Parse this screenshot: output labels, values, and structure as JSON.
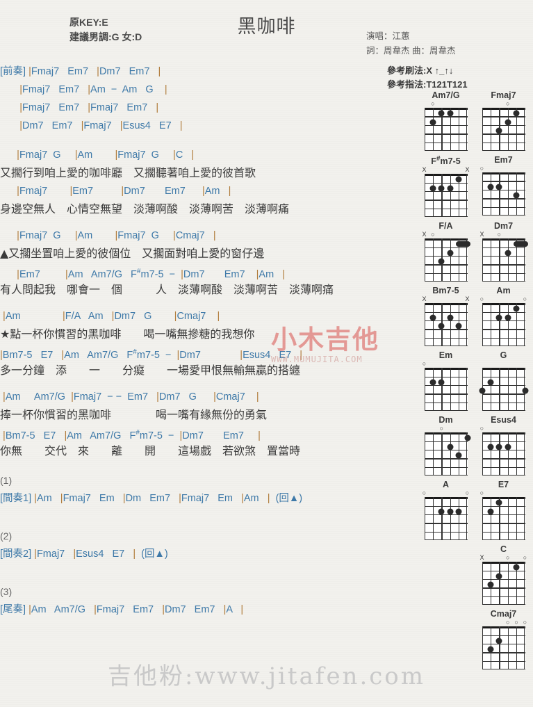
{
  "header": {
    "title": "黑咖啡",
    "orig_key": "原KEY:E",
    "suggest_key": "建議男調:G 女:D",
    "singer": "演唱：江蕙",
    "writer": "詞：周韋杰  曲：周韋杰",
    "strum": "參考刷法:X ↑_↑↓",
    "fingerstyle": "參考指法:T121T121"
  },
  "sections": [
    {
      "name": "intro",
      "label": "[前奏]",
      "lines": [
        {
          "type": "chord",
          "text": "[前奏] |Fmaj7   Em7   |Dm7   Em7   |"
        },
        {
          "type": "chord",
          "text": "       |Fmaj7   Em7   |Am  −  Am   G    |"
        },
        {
          "type": "chord",
          "text": "       |Fmaj7   Em7   |Fmaj7   Em7   |"
        },
        {
          "type": "chord",
          "text": "       |Dm7   Em7   |Fmaj7   |Esus4   E7   |"
        }
      ]
    },
    {
      "name": "verse-1",
      "lines": [
        {
          "type": "chord",
          "text": "      |Fmaj7  G     |Am        |Fmaj7  G     |C   |"
        },
        {
          "type": "lyric",
          "text": "又擱行到咱上愛的咖啡廳　又擱聽著咱上愛的彼首歌"
        },
        {
          "type": "chord",
          "text": "      |Fmaj7        |Em7          |Dm7       Em7      |Am   |"
        },
        {
          "type": "lyric",
          "text": "身邊空無人　心情空無望　淡薄啊酸　淡薄啊苦　淡薄啊痛"
        }
      ]
    },
    {
      "name": "verse-2",
      "lines": [
        {
          "type": "chord",
          "text": "      |Fmaj7  G     |Am        |Fmaj7  G     |Cmaj7   |"
        },
        {
          "type": "lyric",
          "text": "▲又擱坐置咱上愛的彼個位　又擱面對咱上愛的窗仔邊"
        },
        {
          "type": "chord",
          "text": "      |Em7         |Am   Am7/G   F#m7-5  −  |Dm7       Em7    |Am   |"
        },
        {
          "type": "lyric",
          "text": "有人問起我　哪會一　個　　　人　淡薄啊酸　淡薄啊苦　淡薄啊痛"
        }
      ]
    },
    {
      "name": "chorus-1",
      "lines": [
        {
          "type": "chord",
          "text": " |Am               |F/A   Am   |Dm7   G        |Cmaj7    |"
        },
        {
          "type": "lyric",
          "text": "★點一杯你慣習的黑咖啡　　喝一嘴無摻糖的我想你"
        },
        {
          "type": "chord",
          "text": "|Bm7-5   E7   |Am   Am7/G   F#m7-5  −  |Dm7              |Esus4   E7   |"
        },
        {
          "type": "lyric",
          "text": "多一分鐘　添　　一　　分癡　　一場愛甲恨無輸無贏的搭纏"
        }
      ]
    },
    {
      "name": "chorus-2",
      "lines": [
        {
          "type": "chord",
          "text": " |Am     Am7/G  |Fmaj7  − −  Em7   |Dm7   G      |Cmaj7    |"
        },
        {
          "type": "lyric",
          "text": "捧一杯你慣習的黑咖啡　　　　喝一嘴有緣無份的勇氣"
        },
        {
          "type": "chord",
          "text": " |Bm7-5   E7   |Am   Am7/G   F#m7-5  −  |Dm7       Em7     |"
        },
        {
          "type": "lyric",
          "text": "你無　　交代　來　　離　　開　　這場戲　若欲煞　置當時"
        }
      ]
    }
  ],
  "outro_blocks": [
    {
      "num": "(1)",
      "label": "[間奏1]",
      "chords": "|Am   |Fmaj7   Em   |Dm   Em7   |Fmaj7   Em   |Am   |  (回▲)"
    },
    {
      "num": "(2)",
      "label": "[間奏2]",
      "chords": "|Fmaj7   |Esus4   E7   |  (回▲)"
    },
    {
      "num": "(3)",
      "label": "[尾奏]",
      "chords": "|Am   Am7/G   |Fmaj7   Em7   |Dm7   Em7   |A   |"
    }
  ],
  "diagrams": [
    {
      "name": "Am7/G",
      "markers": [
        {
          "sym": "○",
          "string": 5
        }
      ],
      "dots": [
        {
          "s": 5,
          "f": 2
        },
        {
          "s": 4,
          "f": 1
        },
        {
          "s": 3,
          "f": 1
        }
      ],
      "barre": null
    },
    {
      "name": "Fmaj7",
      "markers": [
        {
          "sym": "○",
          "string": 3
        }
      ],
      "dots": [
        {
          "s": 4,
          "f": 3
        },
        {
          "s": 3,
          "f": 2
        },
        {
          "s": 2,
          "f": 1
        }
      ],
      "barre": null
    },
    {
      "name": "F#m7-5",
      "markers": [
        {
          "sym": "X",
          "string": 6
        },
        {
          "sym": "X",
          "string": 1
        }
      ],
      "dots": [
        {
          "s": 5,
          "f": 2
        },
        {
          "s": 4,
          "f": 2
        },
        {
          "s": 3,
          "f": 2
        },
        {
          "s": 2,
          "f": 1
        }
      ],
      "barre": null
    },
    {
      "name": "Em7",
      "markers": [
        {
          "sym": "○",
          "string": 6
        }
      ],
      "dots": [
        {
          "s": 5,
          "f": 2
        },
        {
          "s": 4,
          "f": 2
        },
        {
          "s": 2,
          "f": 3
        }
      ],
      "barre": null
    },
    {
      "name": "F/A",
      "markers": [
        {
          "sym": "X",
          "string": 6
        },
        {
          "sym": "○",
          "string": 5
        }
      ],
      "dots": [
        {
          "s": 4,
          "f": 3
        },
        {
          "s": 3,
          "f": 2
        }
      ],
      "barre": {
        "from": 2,
        "to": 1,
        "f": 1
      }
    },
    {
      "name": "Dm7",
      "markers": [
        {
          "sym": "X",
          "string": 6
        },
        {
          "sym": "○",
          "string": 4
        }
      ],
      "dots": [
        {
          "s": 3,
          "f": 2
        }
      ],
      "barre": {
        "from": 2,
        "to": 1,
        "f": 1
      }
    },
    {
      "name": "Bm7-5",
      "markers": [
        {
          "sym": "X",
          "string": 6
        },
        {
          "sym": "X",
          "string": 1
        }
      ],
      "dots": [
        {
          "s": 5,
          "f": 2
        },
        {
          "s": 3,
          "f": 2
        },
        {
          "s": 4,
          "f": 3
        },
        {
          "s": 2,
          "f": 3
        }
      ],
      "barre": null
    },
    {
      "name": "Am",
      "markers": [
        {
          "sym": "○",
          "string": 6
        },
        {
          "sym": "○",
          "string": 1
        }
      ],
      "dots": [
        {
          "s": 4,
          "f": 2
        },
        {
          "s": 3,
          "f": 2
        },
        {
          "s": 2,
          "f": 1
        }
      ],
      "barre": null
    },
    {
      "name": "Em",
      "markers": [
        {
          "sym": "○",
          "string": 6
        }
      ],
      "dots": [
        {
          "s": 5,
          "f": 2
        },
        {
          "s": 4,
          "f": 2
        }
      ],
      "barre": null
    },
    {
      "name": "G",
      "markers": [],
      "dots": [
        {
          "s": 6,
          "f": 3
        },
        {
          "s": 5,
          "f": 2
        },
        {
          "s": 1,
          "f": 3
        }
      ],
      "barre": null
    },
    {
      "name": "Dm",
      "markers": [
        {
          "sym": "○",
          "string": 4
        }
      ],
      "dots": [
        {
          "s": 3,
          "f": 2
        },
        {
          "s": 2,
          "f": 3
        },
        {
          "s": 1,
          "f": 1
        }
      ],
      "barre": null
    },
    {
      "name": "Esus4",
      "markers": [
        {
          "sym": "○",
          "string": 6
        }
      ],
      "dots": [
        {
          "s": 5,
          "f": 2
        },
        {
          "s": 4,
          "f": 2
        },
        {
          "s": 3,
          "f": 2
        }
      ],
      "barre": null
    },
    {
      "name": "A",
      "markers": [
        {
          "sym": "○",
          "string": 6
        },
        {
          "sym": "○",
          "string": 1
        }
      ],
      "dots": [
        {
          "s": 4,
          "f": 2
        },
        {
          "s": 3,
          "f": 2
        },
        {
          "s": 2,
          "f": 2
        }
      ],
      "barre": null
    },
    {
      "name": "E7",
      "markers": [
        {
          "sym": "○",
          "string": 6
        }
      ],
      "dots": [
        {
          "s": 5,
          "f": 2
        },
        {
          "s": 4,
          "f": 1
        }
      ],
      "barre": null
    },
    {
      "name": "C",
      "markers": [
        {
          "sym": "X",
          "string": 6
        },
        {
          "sym": "○",
          "string": 3
        },
        {
          "sym": "○",
          "string": 1
        }
      ],
      "dots": [
        {
          "s": 5,
          "f": 3
        },
        {
          "s": 4,
          "f": 2
        },
        {
          "s": 2,
          "f": 1
        }
      ],
      "barre": null
    },
    {
      "name": "Cmaj7",
      "markers": [
        {
          "sym": "○",
          "string": 3
        },
        {
          "sym": "○",
          "string": 2
        },
        {
          "sym": "○",
          "string": 1
        }
      ],
      "dots": [
        {
          "s": 5,
          "f": 3
        },
        {
          "s": 4,
          "f": 2
        }
      ],
      "barre": null
    }
  ],
  "diagram_layout": [
    [
      "Am7/G",
      "Fmaj7"
    ],
    [
      "F#m7-5",
      "Em7"
    ],
    [
      "F/A",
      "Dm7"
    ],
    [
      "Bm7-5",
      "Am"
    ],
    [
      "Em",
      "G"
    ],
    [
      "Dm",
      "Esus4"
    ],
    [
      "A",
      "E7"
    ],
    [
      null,
      "C"
    ],
    [
      null,
      "Cmaj7"
    ]
  ],
  "watermarks": {
    "center_cn": "小木吉他",
    "center_url": "WWW.MUMUJITA.COM",
    "bottom": "吉他粉:www.jitafen.com"
  }
}
